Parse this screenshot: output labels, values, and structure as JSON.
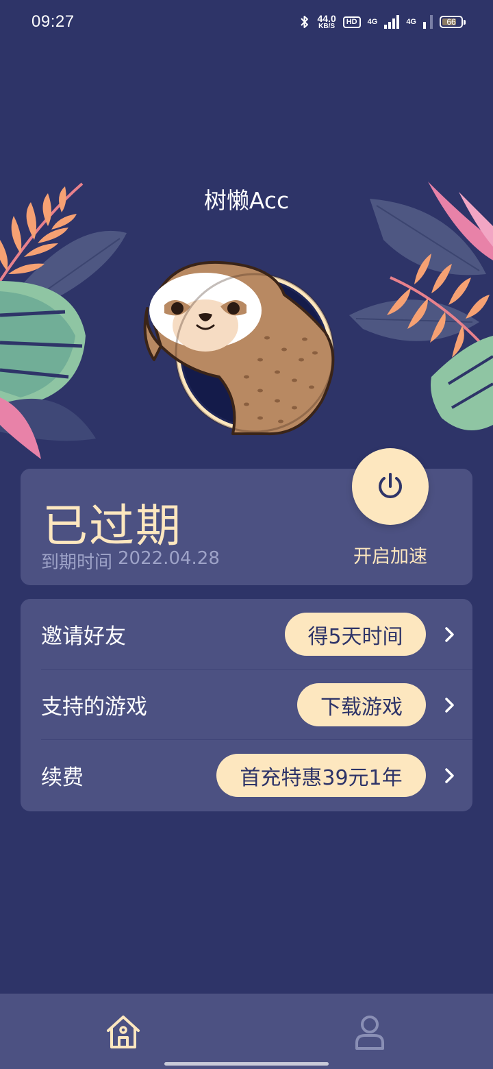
{
  "status_bar": {
    "time": "09:27",
    "speed_value": "44.0",
    "speed_unit": "KB/S",
    "hd_label": "HD",
    "net1_label": "4G",
    "net2_label": "4G",
    "battery_level": "66",
    "icons": [
      "bluetooth-icon",
      "signal-icon",
      "battery-icon"
    ]
  },
  "header": {
    "title": "树懒Acc"
  },
  "status_card": {
    "state_text": "已过期",
    "expire_label": "到期时间",
    "expire_date": "2022.04.28",
    "power_label": "开启加速",
    "power_icon": "power-icon"
  },
  "menu": {
    "items": [
      {
        "label": "邀请好友",
        "pill": "得5天时间"
      },
      {
        "label": "支持的游戏",
        "pill": "下载游戏"
      },
      {
        "label": "续费",
        "pill": "首充特惠39元1年"
      }
    ]
  },
  "bottom_nav": {
    "items": [
      {
        "icon": "home-icon",
        "active": true
      },
      {
        "icon": "user-icon",
        "active": false
      }
    ]
  },
  "colors": {
    "background": "#2e3468",
    "card": "#4c5182",
    "accent": "#fde7bf",
    "muted_text": "#9ea3c8"
  }
}
